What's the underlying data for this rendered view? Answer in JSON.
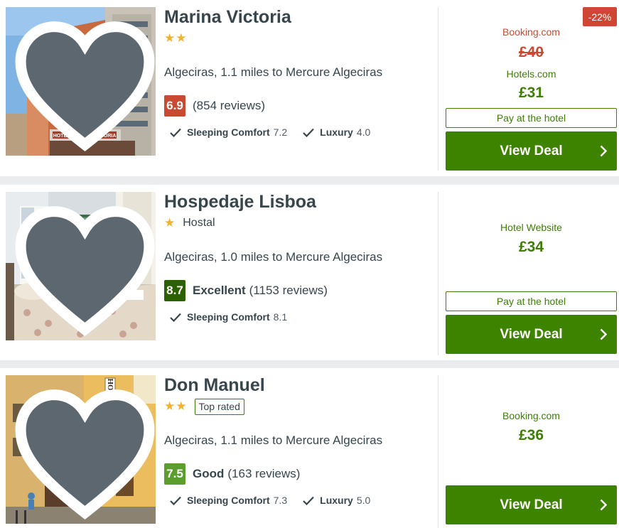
{
  "colors": {
    "brand_green": "#3e8300",
    "price_green": "#3e7d06",
    "strike_red": "#c94a33",
    "discount_bg": "#cf4734",
    "star": "#f4b12d"
  },
  "hotels": [
    {
      "name": "Marina Victoria",
      "stars": 2,
      "category": "",
      "top_rated": "",
      "location": "Algeciras, 1.1 miles to Mercure Algeciras",
      "score": "6.9",
      "score_color": "#c94a33",
      "score_label": "",
      "reviews": "(854 reviews)",
      "subratings": [
        {
          "name": "Sleeping Comfort",
          "value": "7.2"
        },
        {
          "name": "Luxury",
          "value": "4.0"
        }
      ],
      "image_alt": "Hotel Marina Victoria building",
      "sign_text": "HOTEL MARINA VICTORIA",
      "discount": "-22%",
      "original_provider": "Booking.com",
      "original_price": "£40",
      "provider": "Hotels.com",
      "price": "£31",
      "pay_at_hotel": "Pay at the hotel",
      "deal_label": "View Deal"
    },
    {
      "name": "Hospedaje Lisboa",
      "stars": 1,
      "category": "Hostal",
      "top_rated": "",
      "location": "Algeciras, 1.0 miles to Mercure Algeciras",
      "score": "8.7",
      "score_color": "#2c6100",
      "score_label": "Excellent",
      "reviews": "(1153 reviews)",
      "subratings": [
        {
          "name": "Sleeping Comfort",
          "value": "8.1"
        }
      ],
      "image_alt": "Hospedaje Lisboa bedroom",
      "provider": "Hotel Website",
      "price": "£34",
      "pay_at_hotel": "Pay at the hotel",
      "deal_label": "View Deal"
    },
    {
      "name": "Don Manuel",
      "stars": 2,
      "category": "",
      "top_rated": "Top rated",
      "location": "Algeciras, 1.1 miles to Mercure Algeciras",
      "score": "7.5",
      "score_color": "#5b9e2e",
      "score_label": "Good",
      "reviews": "(163 reviews)",
      "subratings": [
        {
          "name": "Sleeping Comfort",
          "value": "7.3"
        },
        {
          "name": "Luxury",
          "value": "5.0"
        }
      ],
      "image_alt": "Hotel Don Manuel street view",
      "sign_text": "HOTEL",
      "provider": "Booking.com",
      "price": "£36",
      "deal_label": "View Deal"
    }
  ]
}
